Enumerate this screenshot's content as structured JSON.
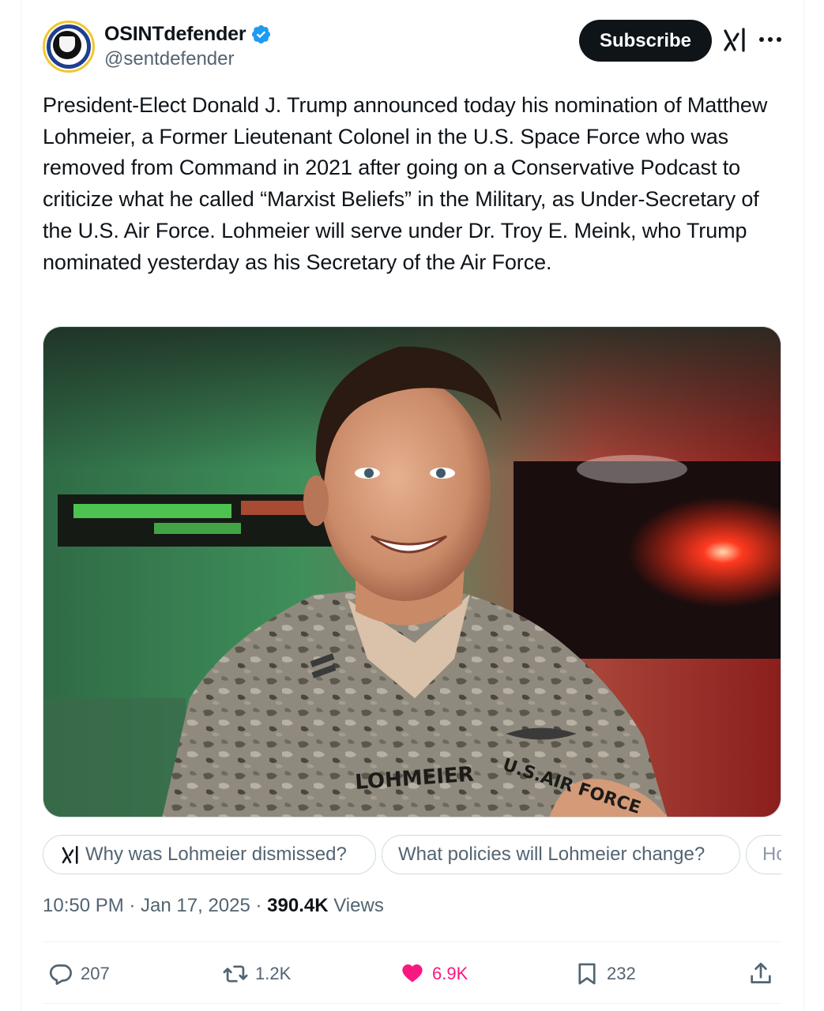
{
  "author": {
    "display_name": "OSINTdefender",
    "handle": "@sentdefender",
    "verified": true,
    "verified_color": "#1d9bf0",
    "avatar_icon": "shield-emblem-icon"
  },
  "header": {
    "subscribe_label": "Subscribe",
    "grok_icon": "grok-icon",
    "more_icon": "more-icon"
  },
  "tweet": {
    "text": "President-Elect Donald J. Trump announced today his nomination of Matthew Lohmeier, a Former Lieutenant Colonel in the U.S. Space Force who was removed from Command in 2021 after going on a Conservative Podcast to criticize what he called “Marxist Beliefs” in the Military, as Under-Secretary of the U.S. Air Force. Lohmeier will serve under Dr. Troy E. Meink, who Trump nominated yesterday as his Secretary of the Air Force."
  },
  "media": {
    "nametape": "LOHMEIER",
    "service_tape": "U.S.AIR FORCE"
  },
  "grok_suggestions": [
    "Why was Lohmeier dismissed?",
    "What policies will Lohmeier change?",
    "Ho"
  ],
  "meta": {
    "timestamp": "10:50 PM · Jan 17, 2025 · ",
    "views_count": "390.4K",
    "views_label": "Views"
  },
  "actions": {
    "replies": "207",
    "reposts": "1.2K",
    "likes": "6.9K",
    "bookmarks": "232",
    "liked": true,
    "like_color": "#f91880"
  }
}
